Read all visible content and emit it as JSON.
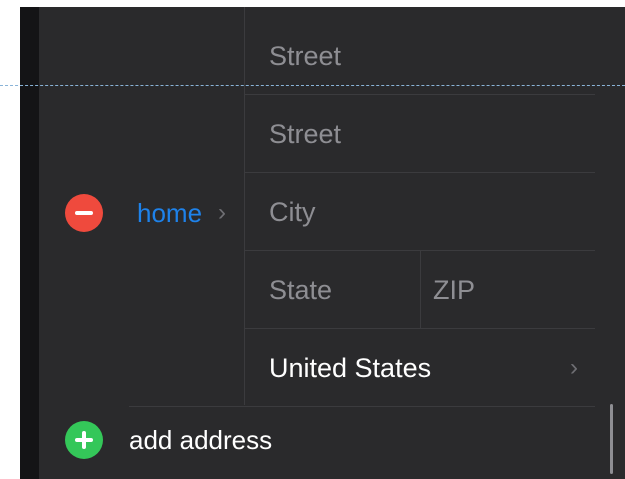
{
  "address": {
    "label": "home",
    "fields": {
      "street1_placeholder": "Street",
      "street2_placeholder": "Street",
      "city_placeholder": "City",
      "state_placeholder": "State",
      "zip_placeholder": "ZIP",
      "country_value": "United States"
    }
  },
  "actions": {
    "add_address_label": "add address"
  },
  "icons": {
    "remove": "minus-circle-icon",
    "add": "plus-circle-icon",
    "label_chevron": "chevron-right-icon",
    "country_chevron": "chevron-right-icon"
  },
  "colors": {
    "background": "#2a2a2c",
    "label_blue": "#1e82ea",
    "remove_red": "#ef4a3d",
    "add_green": "#34c759",
    "placeholder_gray": "#8e8e93",
    "value_white": "#ffffff"
  }
}
